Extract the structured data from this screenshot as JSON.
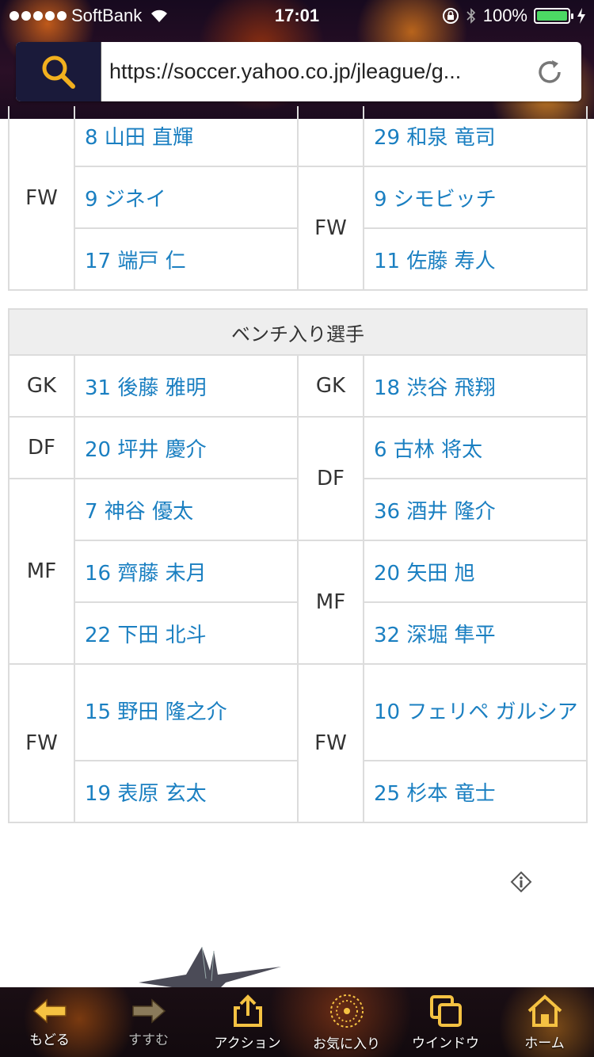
{
  "status_bar": {
    "carrier": "SoftBank",
    "time": "17:01",
    "battery": "100%"
  },
  "browser": {
    "url": "https://soccer.yahoo.co.jp/jleague/g..."
  },
  "starting": {
    "rows": [
      {
        "left_pos": "",
        "left_player": "8 山田 直輝",
        "right_pos": "",
        "right_player": "29 和泉 竜司"
      },
      {
        "left_pos": "FW",
        "left_player": "9 ジネイ",
        "right_pos": "FW",
        "right_player": "9 シモビッチ"
      },
      {
        "left_player": "17 端戸 仁",
        "right_player": "11 佐藤 寿人"
      }
    ]
  },
  "bench": {
    "title": "ベンチ入り選手",
    "gk": {
      "left_pos": "GK",
      "left_player": "31 後藤 雅明",
      "right_pos": "GK",
      "right_player": "18 渋谷 飛翔"
    },
    "df": {
      "left_pos": "DF",
      "left_player": "20 坪井 慶介",
      "right_pos": "DF",
      "right_player": "6 古林 将太"
    },
    "mf": {
      "left_pos": "MF",
      "right_pos": "MF",
      "left_players": [
        "7 神谷 優太",
        "16 齊藤 未月",
        "22 下田 北斗"
      ],
      "right_df_extra": "36 酒井 隆介",
      "right_players": [
        "20 矢田 旭",
        "32 深堀 隼平"
      ]
    },
    "fw": {
      "left_pos": "FW",
      "right_pos": "FW",
      "left_players": [
        "15 野田 隆之介",
        "19 表原 玄太"
      ],
      "right_players": [
        "10 フェリペ ガルシア",
        "25 杉本 竜士"
      ]
    }
  },
  "toolbar": {
    "back": "もどる",
    "forward": "すすむ",
    "action": "アクション",
    "favorites": "お気に入り",
    "window": "ウインドウ",
    "home": "ホーム"
  }
}
